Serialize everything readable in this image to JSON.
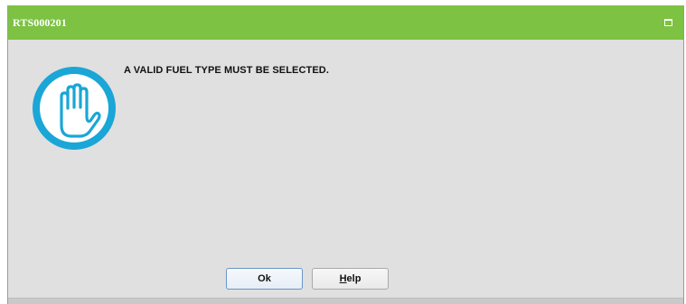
{
  "dialog": {
    "title": "RTS000201",
    "message": "A VALID FUEL TYPE MUST BE SELECTED.",
    "icon": "stop-hand-icon",
    "colors": {
      "titlebar": "#7dc243",
      "icon_ring": "#1aa6d6",
      "background": "#e0e0e0"
    },
    "buttons": {
      "ok_label": "Ok",
      "help_mnemonic": "H",
      "help_rest": "elp"
    }
  }
}
